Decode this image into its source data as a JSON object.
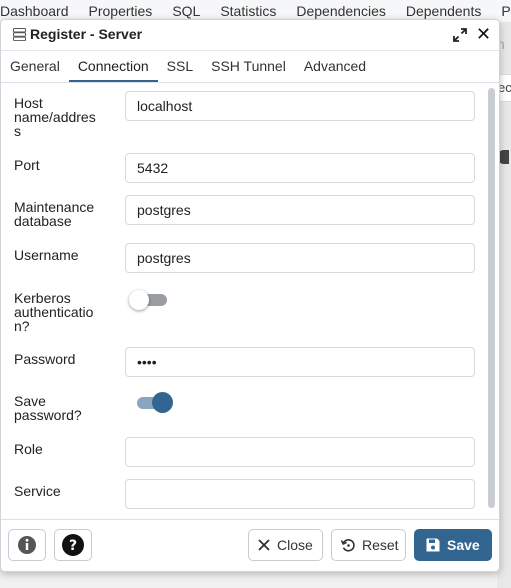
{
  "background": {
    "tabs": [
      "Dashboard",
      "Properties",
      "SQL",
      "Statistics",
      "Dependencies",
      "Dependents",
      "P"
    ],
    "right_fragment_tab": "ec"
  },
  "dialog": {
    "title": "Register - Server",
    "tabs": [
      {
        "label": "General",
        "active": false
      },
      {
        "label": "Connection",
        "active": true
      },
      {
        "label": "SSL",
        "active": false
      },
      {
        "label": "SSH Tunnel",
        "active": false
      },
      {
        "label": "Advanced",
        "active": false
      }
    ],
    "fields": {
      "host": {
        "label": "Host\nname/addres\ns",
        "value": "localhost"
      },
      "port": {
        "label": "Port",
        "value": "5432"
      },
      "maintenance_db": {
        "label": "Maintenance\ndatabase",
        "value": "postgres"
      },
      "username": {
        "label": "Username",
        "value": "postgres"
      },
      "kerberos": {
        "label": "Kerberos\nauthenticatio\nn?",
        "enabled": false
      },
      "password": {
        "label": "Password",
        "value": "••••"
      },
      "save_password": {
        "label": "Save\npassword?",
        "enabled": true
      },
      "role": {
        "label": "Role",
        "value": ""
      },
      "service": {
        "label": "Service",
        "value": ""
      }
    },
    "footer": {
      "info_icon": "info-icon",
      "help_icon": "help-icon",
      "close_label": "Close",
      "reset_label": "Reset",
      "save_label": "Save"
    }
  },
  "colors": {
    "accent": "#326690",
    "toggle_on_track": "#8aa5c0",
    "toggle_off_track": "#9a9ea3",
    "border": "#d6d9de"
  }
}
